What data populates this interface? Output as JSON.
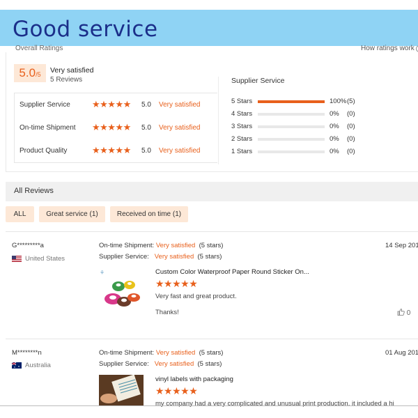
{
  "banner": {
    "title": "Good service"
  },
  "overall": {
    "label": "Overall Ratings",
    "how_link": "How ratings work",
    "score": "5.0",
    "score_suffix": "/5",
    "satisfaction": "Very satisfied",
    "reviews_count": "5 Reviews"
  },
  "categories": [
    {
      "name": "Supplier Service",
      "stars": "★★★★★",
      "score": "5.0",
      "label": "Very satisfied"
    },
    {
      "name": "On-time Shipment",
      "stars": "★★★★★",
      "score": "5.0",
      "label": "Very satisfied"
    },
    {
      "name": "Product Quality",
      "stars": "★★★★★",
      "score": "5.0",
      "label": "Very satisfied"
    }
  ],
  "breakdown": {
    "title": "Supplier Service",
    "rows": [
      {
        "label": "5 Stars",
        "fraction": 1.0,
        "pct": "100%",
        "count": "(5)"
      },
      {
        "label": "4 Stars",
        "fraction": 0.0,
        "pct": "0%",
        "count": "(0)"
      },
      {
        "label": "3 Stars",
        "fraction": 0.0,
        "pct": "0%",
        "count": "(0)"
      },
      {
        "label": "2 Stars",
        "fraction": 0.0,
        "pct": "0%",
        "count": "(0)"
      },
      {
        "label": "1 Stars",
        "fraction": 0.0,
        "pct": "0%",
        "count": "(0)"
      }
    ]
  },
  "all_reviews": {
    "title": "All Reviews"
  },
  "filters": [
    {
      "label": "ALL"
    },
    {
      "label": "Great service (1)"
    },
    {
      "label": "Received on time (1)"
    }
  ],
  "reviews": [
    {
      "user": "G*********a",
      "country": "United States",
      "shipment_label": "On-time Shipment:",
      "shipment_value": "Very satisfied",
      "shipment_stars": "(5 stars)",
      "service_label": "Supplier Service:",
      "service_value": "Very satisfied",
      "service_stars": "(5 stars)",
      "date": "14 Sep 201",
      "product": "Custom Color Waterproof Paper Round Sticker On...",
      "stars": "★★★★★",
      "text": "Very fast and great product.",
      "text2": "Thanks!",
      "likes": "0"
    },
    {
      "user": "M********n",
      "country": "Australia",
      "shipment_label": "On-time Shipment:",
      "shipment_value": "Very satisfied",
      "shipment_stars": "(5 stars)",
      "service_label": "Supplier Service:",
      "service_value": "Very satisfied",
      "service_stars": "(5 stars)",
      "date": "01 Aug 201",
      "product": "vinyl labels with packaging",
      "stars": "★★★★★",
      "text": "my company had a very complicated and unusual print production. it included a hi"
    }
  ],
  "colors": {
    "accent": "#e8601c",
    "banner": "#8fd3f4",
    "badge_bg": "#fde8d7"
  }
}
